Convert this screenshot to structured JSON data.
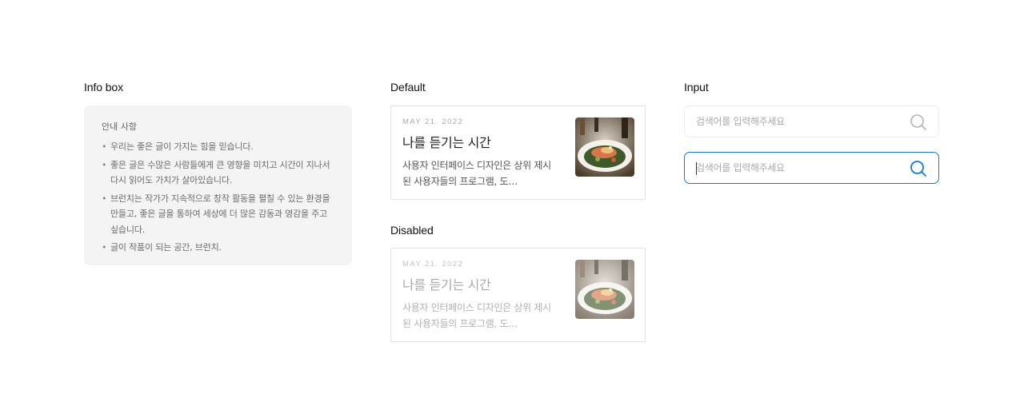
{
  "info_section": {
    "label": "Info box",
    "title": "안내 사항",
    "items": [
      "우리는 좋은 글이 가지는 힘을 믿습니다.",
      "좋은 글은 수많은 사람들에게 큰 영향을 미치고 시간이 지나서 다시 읽어도 가치가 살아있습니다.",
      "브런치는 작가가 지속적으로 창작 활동을 펼칠 수 있는 환경을 만들고, 좋은 글을 통하여 세상에 더 많은 감동과 영감을 주고 싶습니다.",
      "글이 작품이 되는 공간, 브런치."
    ]
  },
  "cards": {
    "default": {
      "label": "Default",
      "date": "MAY 21. 2022",
      "title": "나를 듣기는 시간",
      "excerpt": "사용자 인터페이스 디자인은 상위 제시된 사용자들의 프로그램, 도…"
    },
    "disabled": {
      "label": "Disabled",
      "date": "MAY 21. 2022",
      "title": "나를 듣기는 시간",
      "excerpt": "사용자 인터페이스 디자인은 상위 제시된 사용자들의 프로그램, 도…"
    }
  },
  "input_section": {
    "label": "Input",
    "default_placeholder": "검색어를 입력해주세요",
    "focused_placeholder": "검색어를 입력해주세요",
    "default_icon": "search-icon",
    "focused_icon": "search-icon"
  },
  "colors": {
    "accent": "#1479d9",
    "info_bg": "#f4f4f4",
    "border": "#e3e3e3"
  }
}
